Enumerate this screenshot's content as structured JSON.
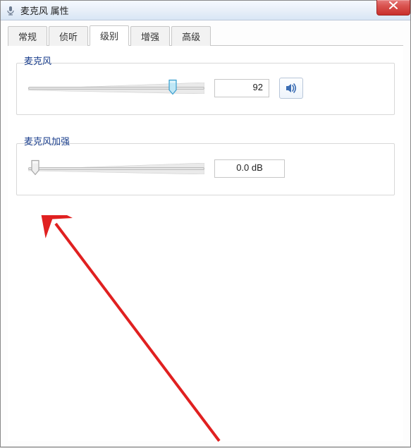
{
  "window": {
    "title": "麦克风 属性"
  },
  "tabs": {
    "general": "常规",
    "listen": "侦听",
    "levels": "级别",
    "enhance": "增强",
    "advanced": "高级"
  },
  "mic": {
    "label": "麦克风",
    "value": "92",
    "slider_percent": 82
  },
  "boost": {
    "label": "麦克风加强",
    "value": "0.0 dB",
    "slider_percent": 4
  }
}
